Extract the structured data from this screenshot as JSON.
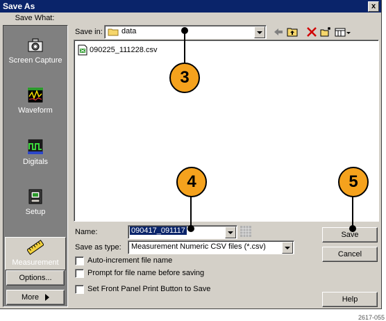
{
  "window": {
    "title": "Save As",
    "close_glyph": "x"
  },
  "left_panel": {
    "header": "Save What:",
    "items": [
      {
        "label": "Screen Capture",
        "icon": "camera-icon",
        "selected": false
      },
      {
        "label": "Waveform",
        "icon": "waveform-icon",
        "selected": false
      },
      {
        "label": "Digitals",
        "icon": "digitals-icon",
        "selected": false
      },
      {
        "label": "Setup",
        "icon": "setup-icon",
        "selected": false
      },
      {
        "label": "Measurement",
        "icon": "ruler-icon",
        "selected": true
      }
    ],
    "options_label": "Options...",
    "more_label": "More"
  },
  "save_in": {
    "label": "Save in:",
    "value": "data"
  },
  "files": [
    {
      "name": "090225_111228.csv",
      "icon": "csv-file-icon"
    }
  ],
  "name_field": {
    "label": "Name:",
    "value": "090417_091117"
  },
  "type_field": {
    "label": "Save as type:",
    "value": "Measurement Numeric CSV files (*.csv)"
  },
  "checkboxes": [
    {
      "label": "Auto-increment file name",
      "checked": false
    },
    {
      "label": "Prompt for file name before saving",
      "checked": false
    },
    {
      "label": "Set Front Panel Print Button to Save",
      "checked": false
    }
  ],
  "buttons": {
    "save": "Save",
    "cancel": "Cancel",
    "help": "Help"
  },
  "callouts": [
    "3",
    "4",
    "5"
  ],
  "figure_number": "2617-055",
  "colors": {
    "title_bar": "#0a246a",
    "callout": "#f5a21d",
    "dialog": "#d4d0c8",
    "selection": "#0a246a"
  }
}
